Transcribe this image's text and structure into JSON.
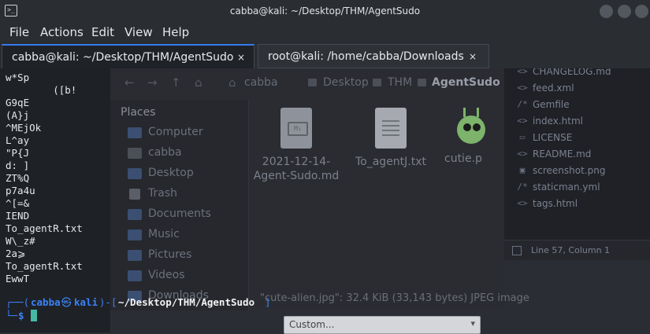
{
  "window": {
    "title": "cabba@kali: ~/Desktop/THM/AgentSudo"
  },
  "menu": [
    "File",
    "Actions",
    "Edit",
    "View",
    "Help"
  ],
  "tabs": [
    {
      "label": "cabba@kali: ~/Desktop/THM/AgentSudo",
      "close": "×"
    },
    {
      "label": "root@kali: /home/cabba/Downloads",
      "close": "×"
    }
  ],
  "terminal": {
    "lines": [
      "w*Sp",
      "        ([b!",
      "G9qE",
      "(A}j",
      "^MEjOk",
      "L^ay",
      "\"P{J",
      "d: ]",
      "ZT%Q",
      "p7a4u",
      "^[=&",
      "IEND",
      "To_agentR.txt",
      "W\\_z#",
      "2a⩾",
      "To_agentR.txt",
      "EwwT"
    ],
    "prompt": {
      "open": "┌──(",
      "user": "cabba",
      "at": "㉿",
      "host": "kali",
      "mid": ")-[",
      "path": "~/Desktop/THM/AgentSudo",
      "close": "]",
      "second": "└─",
      "dollar": "$"
    }
  },
  "file_manager": {
    "breadcrumbs": [
      "cabba",
      "Desktop",
      "THM",
      "AgentSudo"
    ],
    "places_header": "Places",
    "places": [
      "Computer",
      "cabba",
      "Desktop",
      "Trash",
      "Documents",
      "Music",
      "Pictures",
      "Videos",
      "Downloads"
    ],
    "files": [
      "2021-12-14-Agent-Sudo.md",
      "To_agentJ.txt",
      "cutie.p"
    ]
  },
  "editor": {
    "files": [
      {
        "icon": "<>",
        "name": "CHANGELOG.md"
      },
      {
        "icon": "<>",
        "name": "feed.xml"
      },
      {
        "icon": "/*",
        "name": "Gemfile"
      },
      {
        "icon": "<>",
        "name": "index.html"
      },
      {
        "icon": "▭",
        "name": "LICENSE"
      },
      {
        "icon": "<>",
        "name": "README.md"
      },
      {
        "icon": "▣",
        "name": "screenshot.png"
      },
      {
        "icon": "/*",
        "name": "staticman.yml"
      },
      {
        "icon": "<>",
        "name": "tags.html"
      }
    ],
    "status": "Line 57, Column 1"
  },
  "image_viewer": {
    "info": "\"cute-alien.jpg\": 32.4 KiB (33,143 bytes) JPEG image",
    "zoom": "Custom..."
  },
  "colors": {
    "accent": "#367bf0",
    "prompt_blue": "#3b82f6",
    "cursor": "#45b9a6"
  }
}
